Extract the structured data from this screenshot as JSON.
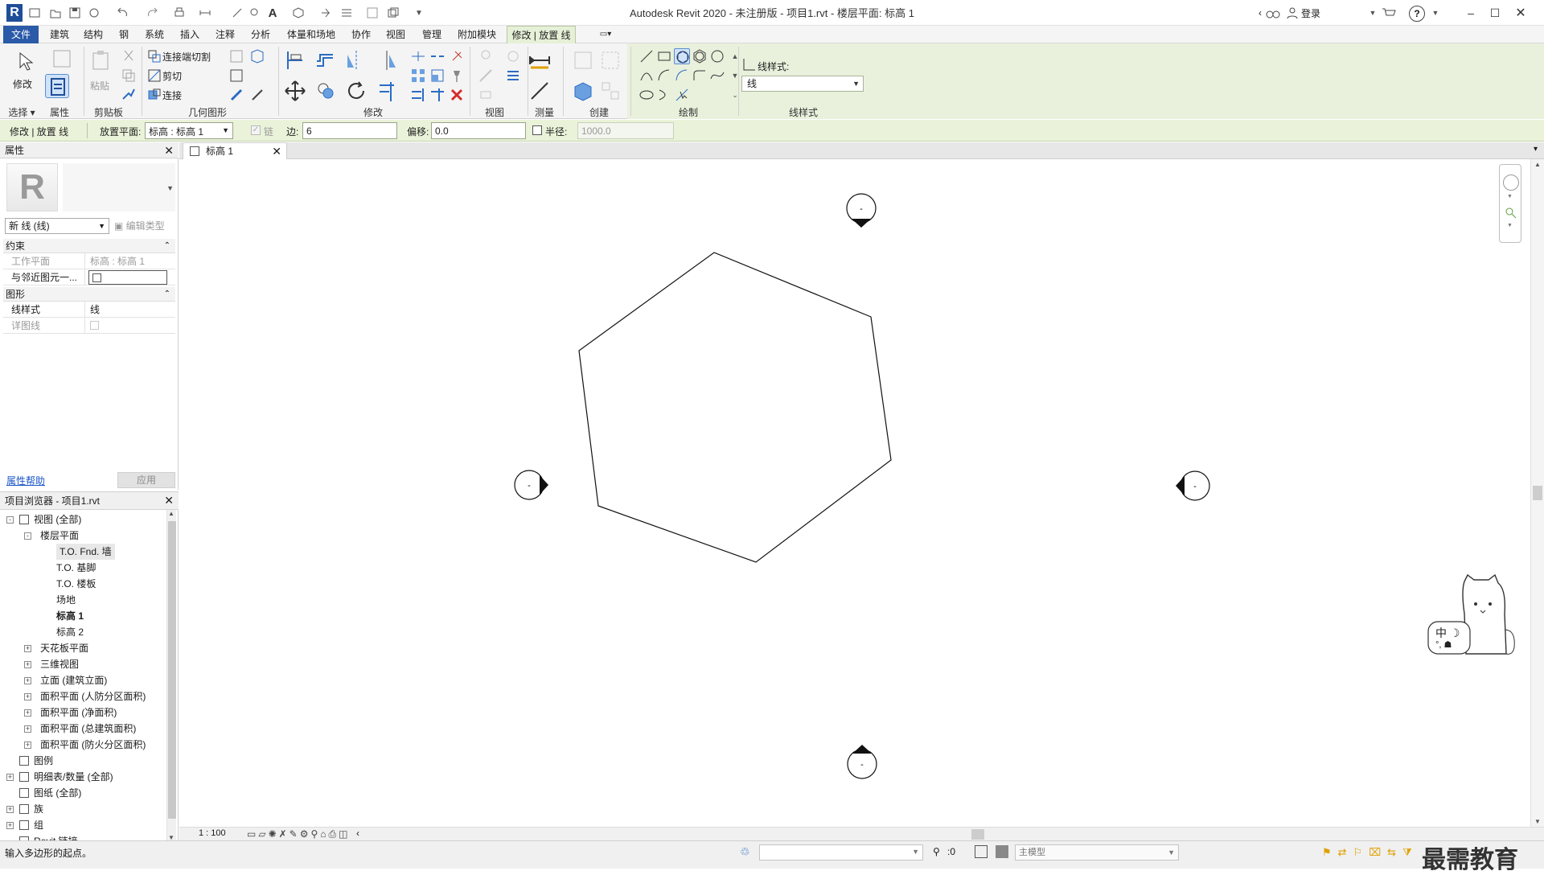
{
  "app": {
    "title": "Autodesk Revit 2020 - 未注册版 - 项目1.rvt - 楼层平面: 标高 1",
    "sign_in": "登录",
    "help": "?"
  },
  "ribbon_tabs": [
    "文件",
    "建筑",
    "结构",
    "钢",
    "系统",
    "插入",
    "注释",
    "分析",
    "体量和场地",
    "协作",
    "视图",
    "管理",
    "附加模块",
    "修改 | 放置 线"
  ],
  "ribbon": {
    "select_label": "修改",
    "paste_label": "粘贴",
    "join_cut": "连接端切割",
    "cut": "剪切",
    "join": "连接",
    "line_style_title": "线样式:",
    "line_style_value": "线",
    "panels": [
      "选择",
      "属性",
      "剪贴板",
      "几何图形",
      "修改",
      "视图",
      "测量",
      "创建",
      "绘制",
      "线样式"
    ]
  },
  "options_bar": {
    "context": "修改 | 放置 线",
    "placement_plane_label": "放置平面:",
    "placement_plane_value": "标高 : 标高 1",
    "chain_label": "链",
    "sides_label": "边:",
    "sides_value": "6",
    "offset_label": "偏移:",
    "offset_value": "0.0",
    "radius_label": "半径:",
    "radius_value": "1000.0"
  },
  "properties": {
    "title": "属性",
    "type_selector": "新 线 (线)",
    "edit_type": "编辑类型",
    "groups": [
      {
        "name": "约束",
        "rows": [
          {
            "label": "工作平面",
            "value": "标高 : 标高 1"
          },
          {
            "label": "与邻近图元一...",
            "value": ""
          }
        ]
      },
      {
        "name": "图形",
        "rows": [
          {
            "label": "线样式",
            "value": "线"
          },
          {
            "label": "详图线",
            "value": ""
          }
        ]
      }
    ],
    "help_link": "属性帮助",
    "apply": "应用"
  },
  "project_browser": {
    "title": "项目浏览器 - 项目1.rvt",
    "items": [
      {
        "label": "视图 (全部)",
        "level": 0,
        "expander": "-"
      },
      {
        "label": "楼层平面",
        "level": 1,
        "expander": "-"
      },
      {
        "label": "T.O. Fnd. 墙",
        "level": 2,
        "expander": ""
      },
      {
        "label": "T.O. 基脚",
        "level": 2,
        "expander": ""
      },
      {
        "label": "T.O. 楼板",
        "level": 2,
        "expander": ""
      },
      {
        "label": "场地",
        "level": 2,
        "expander": ""
      },
      {
        "label": "标高 1",
        "level": 2,
        "expander": ""
      },
      {
        "label": "标高 2",
        "level": 2,
        "expander": ""
      },
      {
        "label": "天花板平面",
        "level": 1,
        "expander": "+"
      },
      {
        "label": "三维视图",
        "level": 1,
        "expander": "+"
      },
      {
        "label": "立面 (建筑立面)",
        "level": 1,
        "expander": "+"
      },
      {
        "label": "面积平面 (人防分区面积)",
        "level": 1,
        "expander": "+"
      },
      {
        "label": "面积平面 (净面积)",
        "level": 1,
        "expander": "+"
      },
      {
        "label": "面积平面 (总建筑面积)",
        "level": 1,
        "expander": "+"
      },
      {
        "label": "面积平面 (防火分区面积)",
        "level": 1,
        "expander": "+"
      },
      {
        "label": "图例",
        "level": 0,
        "expander": ""
      },
      {
        "label": "明细表/数量 (全部)",
        "level": 0,
        "expander": "+"
      },
      {
        "label": "图纸 (全部)",
        "level": 0,
        "expander": ""
      },
      {
        "label": "族",
        "level": 0,
        "expander": "+"
      },
      {
        "label": "组",
        "level": 0,
        "expander": "+"
      },
      {
        "label": "Revit 链接",
        "level": 0,
        "expander": ""
      }
    ]
  },
  "view": {
    "tab_title": "标高 1",
    "scale": "1 : 100",
    "marker_text": "-"
  },
  "status": {
    "prompt": "输入多边形的起点。",
    "active_workset": ":0",
    "model": "主模型",
    "watermark": "最需教育",
    "ime": "中"
  },
  "colors": {
    "file_tab": "#2a5aa8",
    "context_tab": "#e6f0d7",
    "options_bar": "#eaf3d9",
    "link": "#1a56c7"
  }
}
